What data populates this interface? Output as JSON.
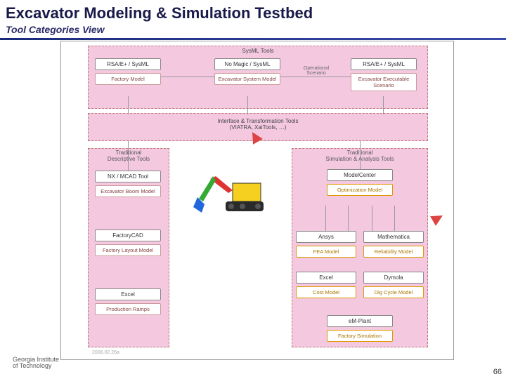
{
  "header": {
    "title": "Excavator Modeling & Simulation Testbed",
    "subtitle": "Tool Categories View"
  },
  "regions": {
    "sysml": "SysML Tools",
    "interface": "Interface & Transformation Tools\n(VIATRA, XaiTools, …)",
    "descriptive": "Traditional\nDescriptive Tools",
    "simulation": "Traditional\nSimulation & Analysis Tools"
  },
  "scenario_label": "Operational Scenario",
  "boxes": {
    "rsa1": {
      "head": "RSA/E+ / SysML",
      "sub": "Factory Model"
    },
    "nomagic": {
      "head": "No Magic / SysML",
      "sub": "Excavator System Model"
    },
    "rsa2": {
      "head": "RSA/E+ / SysML",
      "sub": "Excavator Executable Scenario"
    },
    "nx": {
      "head": "NX / MCAD Tool",
      "sub": "Excavator Boom Model"
    },
    "factorycad": {
      "head": "FactoryCAD",
      "sub": "Factory Layout Model"
    },
    "excel_ramps": {
      "head": "Excel",
      "sub": "Production Ramps"
    },
    "modelcenter": {
      "head": "ModelCenter",
      "sub": "Optimization Model"
    },
    "ansys": {
      "head": "Ansys",
      "sub": "FEA Model"
    },
    "mathematica": {
      "head": "Mathematica",
      "sub": "Reliability Model"
    },
    "excel_cost": {
      "head": "Excel",
      "sub": "Cost Model"
    },
    "dymola": {
      "head": "Dymola",
      "sub": "Dig Cycle Model"
    },
    "emplant": {
      "head": "eM-Plant",
      "sub": "Factory Simulation"
    }
  },
  "footer": {
    "logo_top": "Georgia Institute",
    "logo_bottom": "of Technology",
    "watermark": "2008.02.26a",
    "page": "66"
  }
}
